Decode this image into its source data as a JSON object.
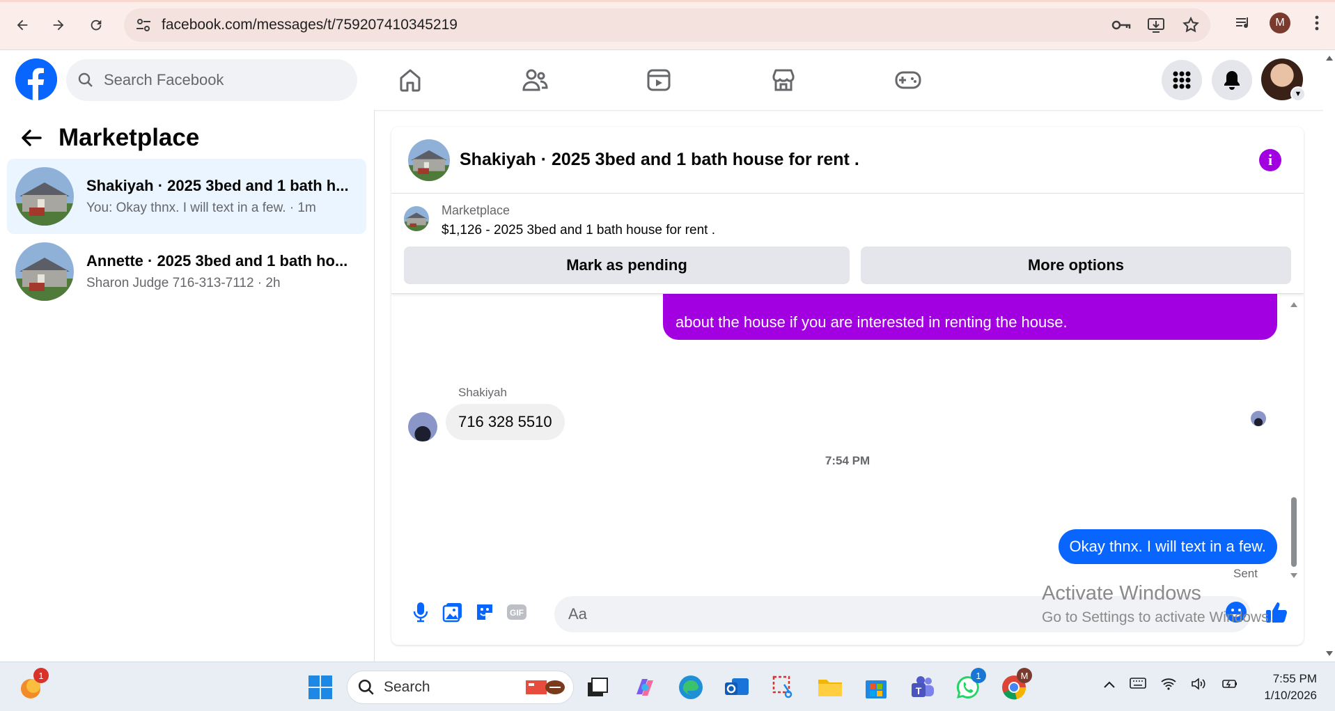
{
  "browser": {
    "url": "facebook.com/messages/t/759207410345219",
    "profile_initial": "M"
  },
  "facebook": {
    "search_placeholder": "Search Facebook",
    "nav_icons": [
      "home-icon",
      "friends-icon",
      "video-icon",
      "marketplace-icon",
      "gaming-icon"
    ]
  },
  "sidebar": {
    "title": "Marketplace",
    "conversations": [
      {
        "name": "Shakiyah · 2025 3bed and 1 bath h...",
        "preview": "You: Okay thnx. I will text in a few. · 1m",
        "active": true
      },
      {
        "name": "Annette · 2025 3bed and 1 bath ho...",
        "preview": "Sharon Judge 716-313-7112 · 2h",
        "active": false
      }
    ]
  },
  "chat": {
    "title": "Shakiyah · 2025 3bed and 1 bath house for rent .",
    "listing": {
      "label": "Marketplace",
      "price_title": "$1,126 - 2025 3bed and 1 bath house for rent .",
      "mark_pending": "Mark as pending",
      "more_options": "More options"
    },
    "messages": {
      "purple_text": "about the house if you are interested in renting the house.",
      "sender": "Shakiyah",
      "received": "716 328 5510",
      "time": "7:54 PM",
      "sent": "Okay thnx. I will text in a few.",
      "status": "Sent"
    },
    "composer_placeholder": "Aa"
  },
  "watermark": {
    "line1": "Activate Windows",
    "line2": "Go to Settings to activate Windows."
  },
  "taskbar": {
    "search": "Search",
    "time": "7:55 PM",
    "date": "1/10/2026",
    "badges": {
      "weather": "1",
      "whatsapp": "1",
      "chrome": "M"
    }
  },
  "colors": {
    "fb_blue": "#0866ff",
    "purple": "#a200e0",
    "active_conv": "#ebf5ff"
  }
}
